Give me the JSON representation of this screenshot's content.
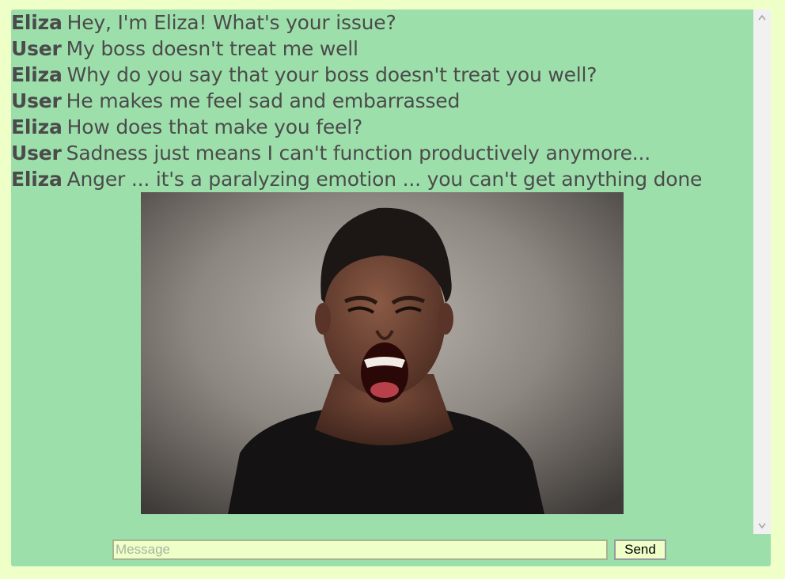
{
  "chat": {
    "messages": [
      {
        "speaker": "Eliza",
        "text": "Hey, I'm Eliza! What's your issue?"
      },
      {
        "speaker": "User",
        "text": "My boss doesn't treat me well"
      },
      {
        "speaker": "Eliza",
        "text": "Why do you say that your boss doesn't treat you well?"
      },
      {
        "speaker": "User",
        "text": "He makes me feel sad and embarrassed"
      },
      {
        "speaker": "Eliza",
        "text": "How does that make you feel?"
      },
      {
        "speaker": "User",
        "text": "Sadness just means I can't function productively anymore..."
      },
      {
        "speaker": "Eliza",
        "text": "Anger ... it's a paralyzing emotion ... you can't get anything done"
      }
    ]
  },
  "composer": {
    "placeholder": "Message",
    "value": "",
    "send_label": "Send"
  },
  "icons": {
    "scroll_up": "chevron-up-icon",
    "scroll_down": "chevron-down-icon"
  },
  "colors": {
    "page_background": "#eeffc8",
    "chat_panel": "#9ddfab",
    "text": "#4b4b4b"
  }
}
